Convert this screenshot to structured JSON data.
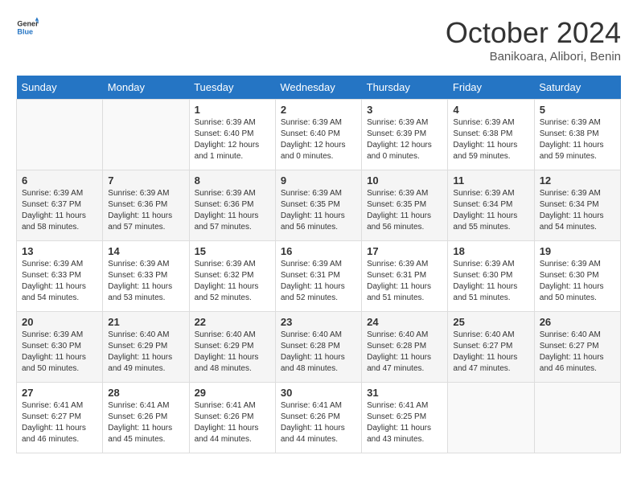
{
  "header": {
    "logo_line1": "General",
    "logo_line2": "Blue",
    "month": "October 2024",
    "location": "Banikoara, Alibori, Benin"
  },
  "weekdays": [
    "Sunday",
    "Monday",
    "Tuesday",
    "Wednesday",
    "Thursday",
    "Friday",
    "Saturday"
  ],
  "weeks": [
    [
      {
        "day": "",
        "sunrise": "",
        "sunset": "",
        "daylight": ""
      },
      {
        "day": "",
        "sunrise": "",
        "sunset": "",
        "daylight": ""
      },
      {
        "day": "1",
        "sunrise": "Sunrise: 6:39 AM",
        "sunset": "Sunset: 6:40 PM",
        "daylight": "Daylight: 12 hours and 1 minute."
      },
      {
        "day": "2",
        "sunrise": "Sunrise: 6:39 AM",
        "sunset": "Sunset: 6:40 PM",
        "daylight": "Daylight: 12 hours and 0 minutes."
      },
      {
        "day": "3",
        "sunrise": "Sunrise: 6:39 AM",
        "sunset": "Sunset: 6:39 PM",
        "daylight": "Daylight: 12 hours and 0 minutes."
      },
      {
        "day": "4",
        "sunrise": "Sunrise: 6:39 AM",
        "sunset": "Sunset: 6:38 PM",
        "daylight": "Daylight: 11 hours and 59 minutes."
      },
      {
        "day": "5",
        "sunrise": "Sunrise: 6:39 AM",
        "sunset": "Sunset: 6:38 PM",
        "daylight": "Daylight: 11 hours and 59 minutes."
      }
    ],
    [
      {
        "day": "6",
        "sunrise": "Sunrise: 6:39 AM",
        "sunset": "Sunset: 6:37 PM",
        "daylight": "Daylight: 11 hours and 58 minutes."
      },
      {
        "day": "7",
        "sunrise": "Sunrise: 6:39 AM",
        "sunset": "Sunset: 6:36 PM",
        "daylight": "Daylight: 11 hours and 57 minutes."
      },
      {
        "day": "8",
        "sunrise": "Sunrise: 6:39 AM",
        "sunset": "Sunset: 6:36 PM",
        "daylight": "Daylight: 11 hours and 57 minutes."
      },
      {
        "day": "9",
        "sunrise": "Sunrise: 6:39 AM",
        "sunset": "Sunset: 6:35 PM",
        "daylight": "Daylight: 11 hours and 56 minutes."
      },
      {
        "day": "10",
        "sunrise": "Sunrise: 6:39 AM",
        "sunset": "Sunset: 6:35 PM",
        "daylight": "Daylight: 11 hours and 56 minutes."
      },
      {
        "day": "11",
        "sunrise": "Sunrise: 6:39 AM",
        "sunset": "Sunset: 6:34 PM",
        "daylight": "Daylight: 11 hours and 55 minutes."
      },
      {
        "day": "12",
        "sunrise": "Sunrise: 6:39 AM",
        "sunset": "Sunset: 6:34 PM",
        "daylight": "Daylight: 11 hours and 54 minutes."
      }
    ],
    [
      {
        "day": "13",
        "sunrise": "Sunrise: 6:39 AM",
        "sunset": "Sunset: 6:33 PM",
        "daylight": "Daylight: 11 hours and 54 minutes."
      },
      {
        "day": "14",
        "sunrise": "Sunrise: 6:39 AM",
        "sunset": "Sunset: 6:33 PM",
        "daylight": "Daylight: 11 hours and 53 minutes."
      },
      {
        "day": "15",
        "sunrise": "Sunrise: 6:39 AM",
        "sunset": "Sunset: 6:32 PM",
        "daylight": "Daylight: 11 hours and 52 minutes."
      },
      {
        "day": "16",
        "sunrise": "Sunrise: 6:39 AM",
        "sunset": "Sunset: 6:31 PM",
        "daylight": "Daylight: 11 hours and 52 minutes."
      },
      {
        "day": "17",
        "sunrise": "Sunrise: 6:39 AM",
        "sunset": "Sunset: 6:31 PM",
        "daylight": "Daylight: 11 hours and 51 minutes."
      },
      {
        "day": "18",
        "sunrise": "Sunrise: 6:39 AM",
        "sunset": "Sunset: 6:30 PM",
        "daylight": "Daylight: 11 hours and 51 minutes."
      },
      {
        "day": "19",
        "sunrise": "Sunrise: 6:39 AM",
        "sunset": "Sunset: 6:30 PM",
        "daylight": "Daylight: 11 hours and 50 minutes."
      }
    ],
    [
      {
        "day": "20",
        "sunrise": "Sunrise: 6:39 AM",
        "sunset": "Sunset: 6:30 PM",
        "daylight": "Daylight: 11 hours and 50 minutes."
      },
      {
        "day": "21",
        "sunrise": "Sunrise: 6:40 AM",
        "sunset": "Sunset: 6:29 PM",
        "daylight": "Daylight: 11 hours and 49 minutes."
      },
      {
        "day": "22",
        "sunrise": "Sunrise: 6:40 AM",
        "sunset": "Sunset: 6:29 PM",
        "daylight": "Daylight: 11 hours and 48 minutes."
      },
      {
        "day": "23",
        "sunrise": "Sunrise: 6:40 AM",
        "sunset": "Sunset: 6:28 PM",
        "daylight": "Daylight: 11 hours and 48 minutes."
      },
      {
        "day": "24",
        "sunrise": "Sunrise: 6:40 AM",
        "sunset": "Sunset: 6:28 PM",
        "daylight": "Daylight: 11 hours and 47 minutes."
      },
      {
        "day": "25",
        "sunrise": "Sunrise: 6:40 AM",
        "sunset": "Sunset: 6:27 PM",
        "daylight": "Daylight: 11 hours and 47 minutes."
      },
      {
        "day": "26",
        "sunrise": "Sunrise: 6:40 AM",
        "sunset": "Sunset: 6:27 PM",
        "daylight": "Daylight: 11 hours and 46 minutes."
      }
    ],
    [
      {
        "day": "27",
        "sunrise": "Sunrise: 6:41 AM",
        "sunset": "Sunset: 6:27 PM",
        "daylight": "Daylight: 11 hours and 46 minutes."
      },
      {
        "day": "28",
        "sunrise": "Sunrise: 6:41 AM",
        "sunset": "Sunset: 6:26 PM",
        "daylight": "Daylight: 11 hours and 45 minutes."
      },
      {
        "day": "29",
        "sunrise": "Sunrise: 6:41 AM",
        "sunset": "Sunset: 6:26 PM",
        "daylight": "Daylight: 11 hours and 44 minutes."
      },
      {
        "day": "30",
        "sunrise": "Sunrise: 6:41 AM",
        "sunset": "Sunset: 6:26 PM",
        "daylight": "Daylight: 11 hours and 44 minutes."
      },
      {
        "day": "31",
        "sunrise": "Sunrise: 6:41 AM",
        "sunset": "Sunset: 6:25 PM",
        "daylight": "Daylight: 11 hours and 43 minutes."
      },
      {
        "day": "",
        "sunrise": "",
        "sunset": "",
        "daylight": ""
      },
      {
        "day": "",
        "sunrise": "",
        "sunset": "",
        "daylight": ""
      }
    ]
  ]
}
